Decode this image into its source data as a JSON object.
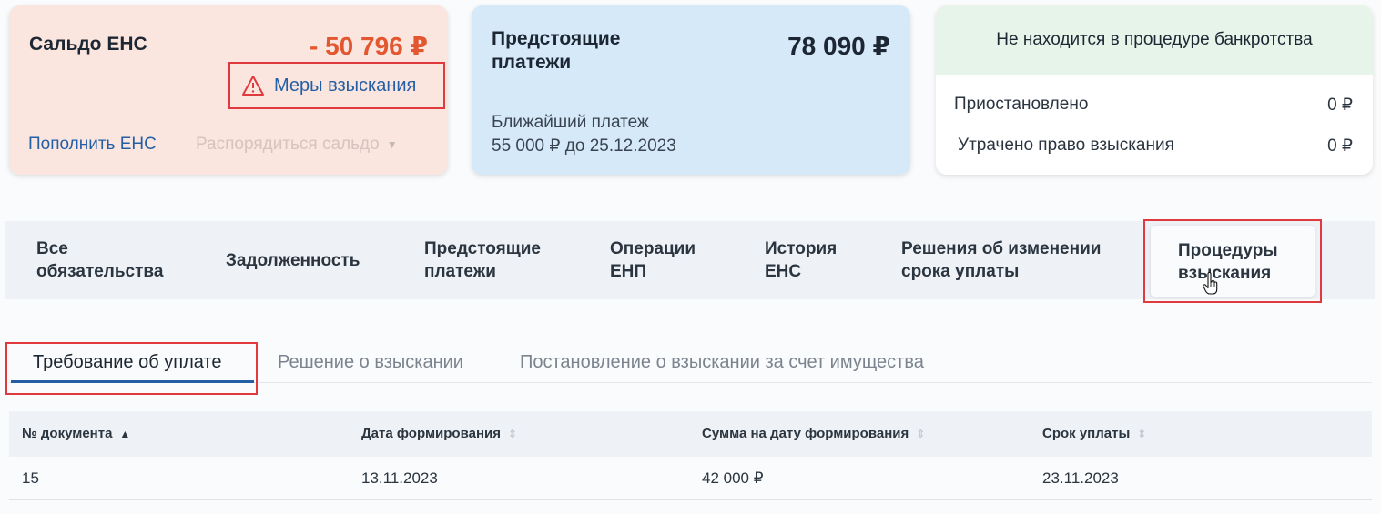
{
  "balance_card": {
    "title": "Сальдо ЕНС",
    "amount": "- 50 796 ₽",
    "enforcement_link": "Меры взыскания",
    "topup_link": "Пополнить ЕНС",
    "manage_balance": "Распорядиться сальдо"
  },
  "upcoming_card": {
    "title": "Предстоящие платежи",
    "amount": "78 090 ₽",
    "nearest_label": "Ближайший платеж",
    "nearest_value": "55 000 ₽ до 25.12.2023"
  },
  "bankruptcy_card": {
    "header": "Не находится в процедуре банкротства",
    "suspended_label": "Приостановлено",
    "suspended_value": "0 ₽",
    "lost_label": "Утрачено право взыскания",
    "lost_value": "0 ₽"
  },
  "main_tabs": {
    "all": [
      "Все",
      "обязательства"
    ],
    "debt": "Задолженность",
    "upcoming": [
      "Предстоящие",
      "платежи"
    ],
    "operations": [
      "Операции",
      "ЕНП"
    ],
    "history": [
      "История",
      "ЕНС"
    ],
    "decisions": [
      "Решения об изменении",
      "срока уплаты"
    ],
    "procedures": [
      "Процедуры",
      "взыскания"
    ]
  },
  "sub_tabs": {
    "demand": "Требование об уплате",
    "decision": "Решение о взыскании",
    "resolution": "Постановление о взыскании за счет имущества"
  },
  "table": {
    "headers": [
      "№ документа",
      "Дата формирования",
      "Сумма на дату формирования",
      "Срок уплаты"
    ],
    "rows": [
      [
        "15",
        "13.11.2023",
        "42 000 ₽",
        "23.11.2023"
      ]
    ]
  },
  "colors": {
    "negative": "#e35730",
    "link": "#245ea5",
    "highlight": "#e0393e"
  }
}
